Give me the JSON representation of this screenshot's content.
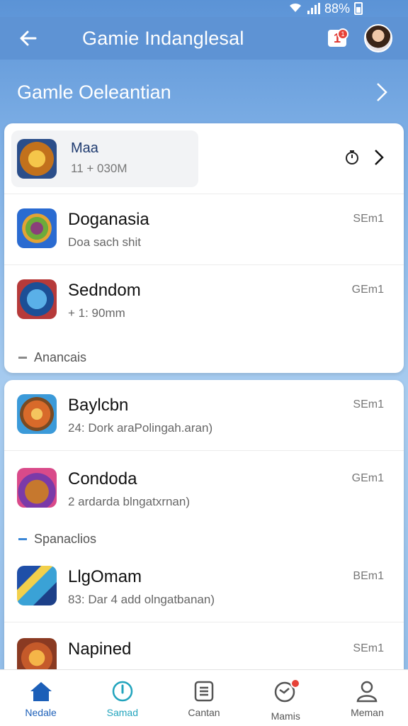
{
  "status_bar": {
    "battery_text": "88%"
  },
  "header": {
    "title": "Gamie Indanglesal",
    "notification_badge": "1"
  },
  "section": {
    "title": "Gamle Oeleantian"
  },
  "featured": {
    "name": "Maa",
    "sub": "11 + 030M"
  },
  "list1": [
    {
      "name": "Doganasia",
      "sub": "Doa sach shit",
      "meta": "SEm1",
      "icon": "orb-game-icon"
    },
    {
      "name": "Sedndom",
      "sub": "+ 1: 90mm",
      "meta": "GEm1",
      "icon": "warrior-game-icon"
    }
  ],
  "group1_label": "Anancais",
  "list2": [
    {
      "name": "Baylcbn",
      "sub": "24: Dork araPolingah.aran)",
      "meta": "SEm1",
      "icon": "shield-game-icon"
    },
    {
      "name": "Condoda",
      "sub": "2 ardarda blngatxrnan)",
      "meta": "GEm1",
      "icon": "bear-game-icon"
    }
  ],
  "group2_label": "Spanaclios",
  "list3": [
    {
      "name": "LlgOmam",
      "sub": "83: Dar 4 add olngatbanan)",
      "meta": "BEm1",
      "icon": "sword-game-icon"
    },
    {
      "name": "Napined",
      "sub": "",
      "meta": "SEm1",
      "icon": "crown-game-icon"
    }
  ],
  "nav": [
    {
      "label": "Nedale",
      "icon": "home-icon"
    },
    {
      "label": "Samad",
      "icon": "compass-icon"
    },
    {
      "label": "Cantan",
      "icon": "document-icon"
    },
    {
      "label": "Mamis",
      "icon": "globe-icon"
    },
    {
      "label": "Meman",
      "icon": "profile-icon"
    }
  ],
  "colors": {
    "accent": "#5e93d4",
    "active_nav": "#1c5fb8",
    "badge": "#e64238"
  }
}
